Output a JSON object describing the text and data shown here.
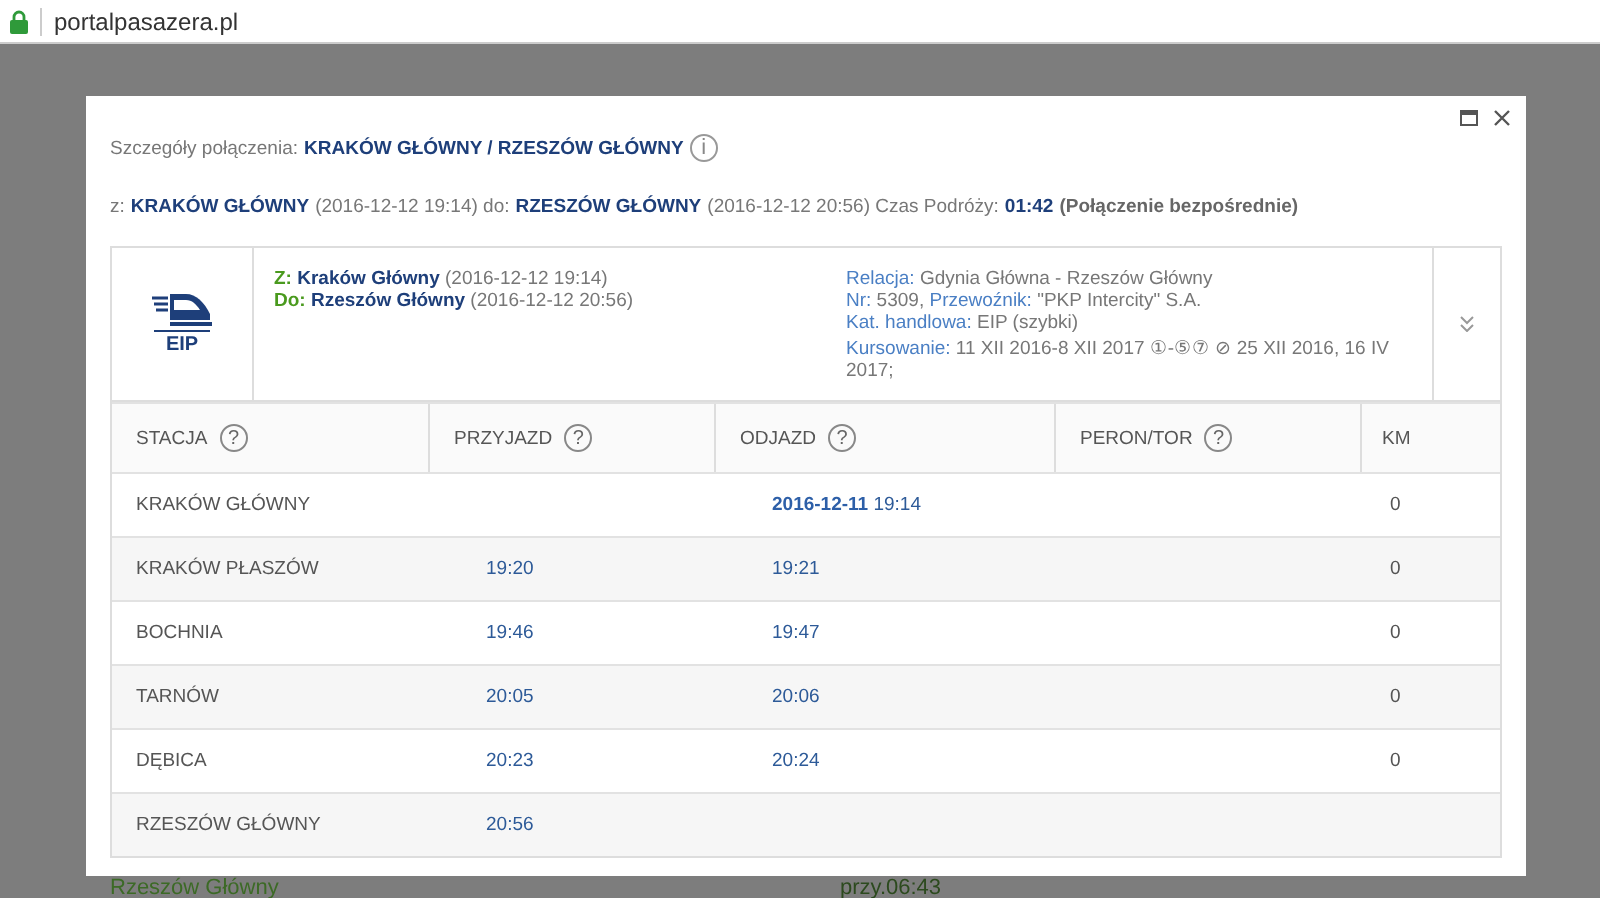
{
  "browser": {
    "url": "portalpasazera.pl"
  },
  "background": {
    "texts": [
      "Rzeszów Główny",
      "przy.06:43"
    ]
  },
  "modal": {
    "title": {
      "label": "Szczegóły połączenia:",
      "route": "KRAKÓW GŁÓWNY / RZESZÓW GŁÓWNY",
      "info": "i"
    },
    "summary": [
      {
        "kind": "label",
        "text": "z:"
      },
      {
        "kind": "value",
        "text": "KRAKÓW GŁÓWNY"
      },
      {
        "kind": "label",
        "text": "(2016-12-12 19:14) do:"
      },
      {
        "kind": "value",
        "text": "RZESZÓW GŁÓWNY"
      },
      {
        "kind": "label",
        "text": "(2016-12-12 20:56) Czas Podróży:"
      },
      {
        "kind": "value",
        "text": "01:42"
      },
      {
        "kind": "note",
        "text": "(Połączenie bezpośrednie)"
      }
    ],
    "train": {
      "category": "EIP",
      "from": {
        "label": "Z:",
        "station": "Kraków Główny",
        "time": "(2016-12-12 19:14)"
      },
      "to": {
        "label": "Do:",
        "station": "Rzeszów Główny",
        "time": "(2016-12-12 20:56)"
      },
      "info": [
        {
          "label": "Relacja:",
          "value": "Gdynia Główna - Rzeszów Główny"
        },
        {
          "label": "Nr:",
          "value": "5309,"
        },
        {
          "label": "Przewoźnik:",
          "value": "\"PKP Intercity\" S.A."
        },
        {
          "label": "Kat. handlowa:",
          "value": "EIP (szybki)"
        },
        {
          "label": "Kursowanie:",
          "value": "11 XII 2016-8 XII 2017 ①-⑤⑦ ⊘ 25 XII 2016, 16 IV 2017;"
        }
      ],
      "expanded": false
    },
    "table": {
      "columns": [
        {
          "label": "STACJA",
          "help": "?"
        },
        {
          "label": "PRZYJAZD",
          "help": "?"
        },
        {
          "label": "ODJAZD",
          "help": "?"
        },
        {
          "label": "PERON/TOR",
          "help": "?"
        },
        {
          "label": "KM"
        }
      ],
      "rows": [
        {
          "station": "KRAKÓW GŁÓWNY",
          "arrival": "",
          "departure_date": "2016-12-11",
          "departure": "19:14",
          "km": "0"
        },
        {
          "station": "KRAKÓW PŁASZÓW",
          "arrival": "19:20",
          "departure": "19:21",
          "km": "0"
        },
        {
          "station": "BOCHNIA",
          "arrival": "19:46",
          "departure": "19:47",
          "km": "0"
        },
        {
          "station": "TARNÓW",
          "arrival": "20:05",
          "departure": "20:06",
          "km": "0"
        },
        {
          "station": "DĘBICA",
          "arrival": "20:23",
          "departure": "20:24",
          "km": "0"
        },
        {
          "station": "RZESZÓW GŁÓWNY",
          "arrival": "20:56",
          "departure": "",
          "km": ""
        }
      ]
    }
  }
}
